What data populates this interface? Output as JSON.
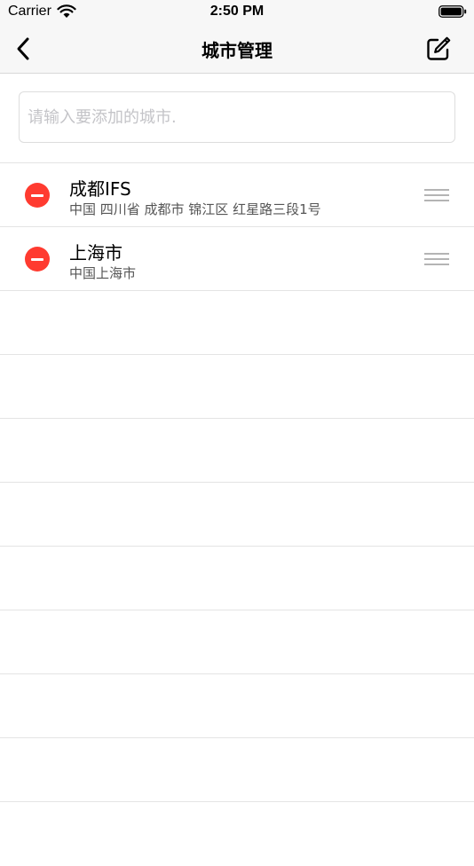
{
  "status_bar": {
    "carrier": "Carrier",
    "time": "2:50 PM"
  },
  "nav": {
    "title": "城市管理",
    "back_icon": "chevron-left-icon",
    "edit_icon": "compose-icon"
  },
  "search": {
    "placeholder": "请输入要添加的城市.",
    "value": ""
  },
  "cities": [
    {
      "name": "成都IFS",
      "address": "中国 四川省 成都市 锦江区 红星路三段1号"
    },
    {
      "name": "上海市",
      "address": "中国上海市"
    }
  ],
  "colors": {
    "delete": "#ff3b30",
    "separator": "#e4e4e4",
    "nav_background": "#f7f7f7"
  }
}
